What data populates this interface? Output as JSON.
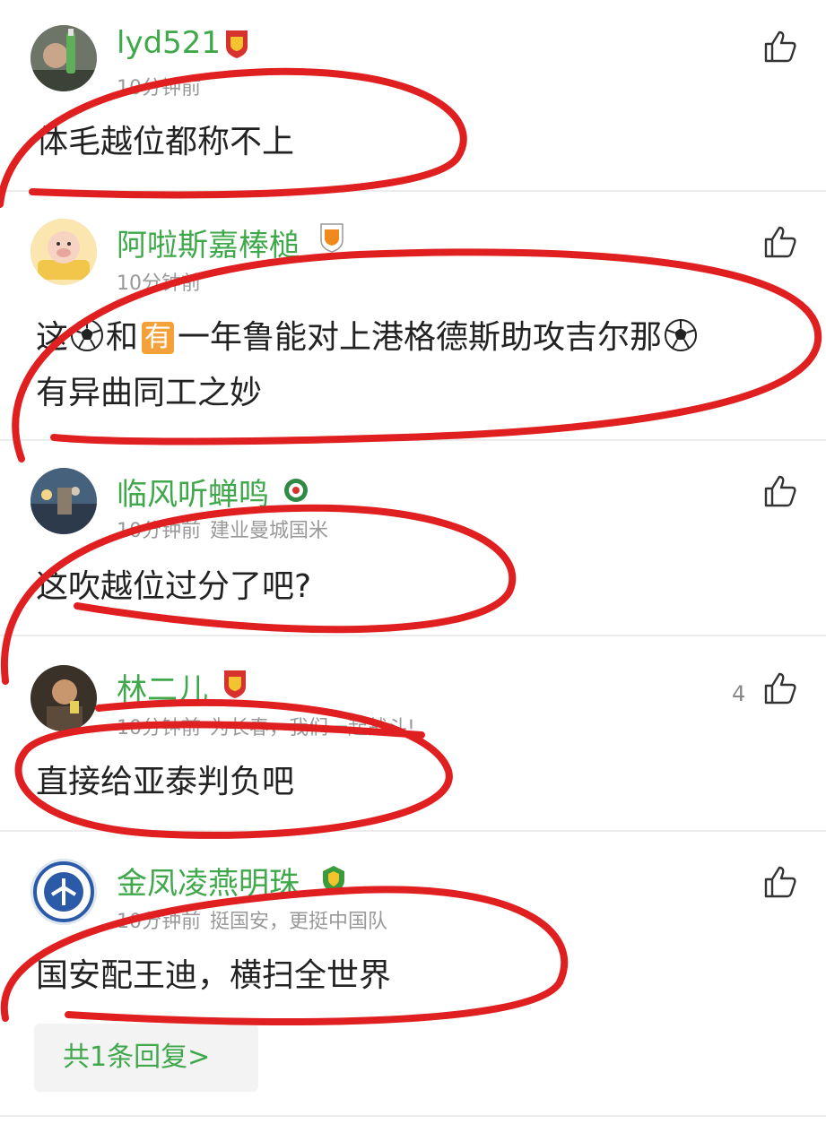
{
  "comments": [
    {
      "username": "lyd521",
      "time": "10分钟前",
      "signature": "",
      "text": "体毛越位都称不上",
      "likes": "",
      "badge_color": "#d8322e",
      "avatar": "man-with-bottle"
    },
    {
      "username": "阿啦斯嘉棒槌",
      "time": "10分钟前",
      "signature": "",
      "text_segments": [
        "这",
        "和",
        "有",
        "一年鲁能对上港格德斯助攻吉尔那",
        "有异曲同工之妙"
      ],
      "likes": "",
      "badge_color": "#f08a1c",
      "avatar": "cartoon-pig"
    },
    {
      "username": "临风听蝉鸣",
      "time": "10分钟前",
      "signature": "建业曼城国米",
      "text": "这吹越位过分了吧?",
      "likes": "",
      "badge_color": "#2f8a46",
      "avatar": "city-night"
    },
    {
      "username": "林二儿",
      "time": "10分钟前",
      "signature": "为长春，我们一起战斗!",
      "text": "直接给亚泰判负吧",
      "likes": "4",
      "badge_color": "#d8322e",
      "avatar": "man-dark"
    },
    {
      "username": "金凤凌燕明珠",
      "time": "10分钟前",
      "signature": "挺国安，更挺中国队",
      "text": "国安配王迪，横扫全世界",
      "likes": "",
      "badge_color": "#3b9a3a",
      "avatar": "university-logo"
    }
  ],
  "reply_button": "共1条回复>",
  "colors": {
    "username": "#3ea84a",
    "meta": "#999999",
    "annotation_red": "#e02020"
  },
  "icons": [
    "thumbs-up-icon",
    "soccer-ball-icon",
    "club-badge-icon"
  ]
}
